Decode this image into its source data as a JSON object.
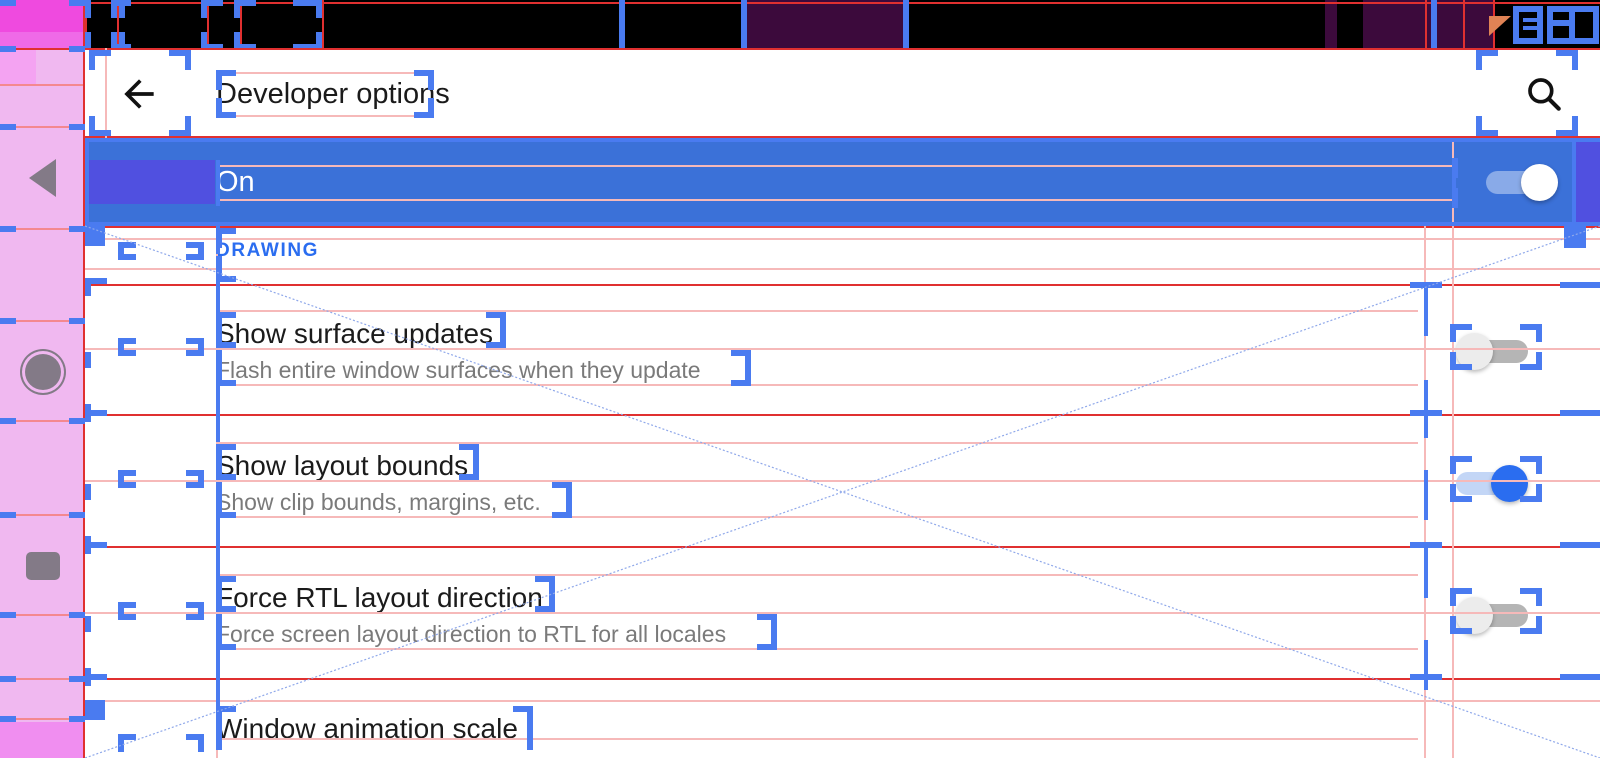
{
  "window": {
    "title": "Developer options"
  },
  "statusbar": {
    "wifi_icon": "wifi-icon",
    "background_color": "#000000"
  },
  "navbar": {
    "back_icon": "triangle-back-icon",
    "home_icon": "circle-home-icon",
    "recents_icon": "square-recents-icon",
    "background_color": "#f0b8f0"
  },
  "toolbar": {
    "back_label": "back-arrow",
    "title": "Developer options",
    "search_label": "search"
  },
  "master_switch": {
    "label": "On",
    "state": "on",
    "accent_color": "#3b71d8"
  },
  "section": {
    "header": "DRAWING",
    "header_color": "#2a6df0"
  },
  "preferences": [
    {
      "title": "Show surface updates",
      "summary": "Flash entire window surfaces when they update",
      "state": "off"
    },
    {
      "title": "Show layout bounds",
      "summary": "Show clip bounds, margins, etc.",
      "state": "on"
    },
    {
      "title": "Force RTL layout direction",
      "summary": "Force screen layout direction to RTL for all locales",
      "state": "off"
    },
    {
      "title": "Window animation scale",
      "summary": "",
      "state": "none"
    }
  ],
  "debug_overlay": {
    "enabled": true,
    "bounds_color": "#4a7bf0",
    "margin_color": "#e03030",
    "optical_color": "#f6b9b9"
  }
}
